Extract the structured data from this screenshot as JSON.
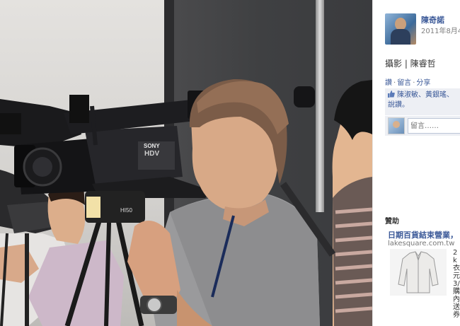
{
  "photo": {
    "camera_brand": "SONY",
    "camera_model": "HDV",
    "tripod_label": "HI50"
  },
  "post": {
    "poster_name": "陳奇諾",
    "date": "2011年8月4",
    "caption": "攝影 | 陳睿哲",
    "actions": [
      "讚",
      "留言",
      "分享"
    ],
    "likes_text": "陳淑敏、黃銀瑤、",
    "likes_more": "說讚。",
    "comment_placeholder": "留言……"
  },
  "ads": {
    "section_title": "贊助",
    "headline": "日期百貨結束營業，",
    "url": "lakesquare.com.tw",
    "text": "2k衣元3/購內送券"
  },
  "colors": {
    "link": "#3b5998",
    "highlight_bg": "#edeff4"
  }
}
